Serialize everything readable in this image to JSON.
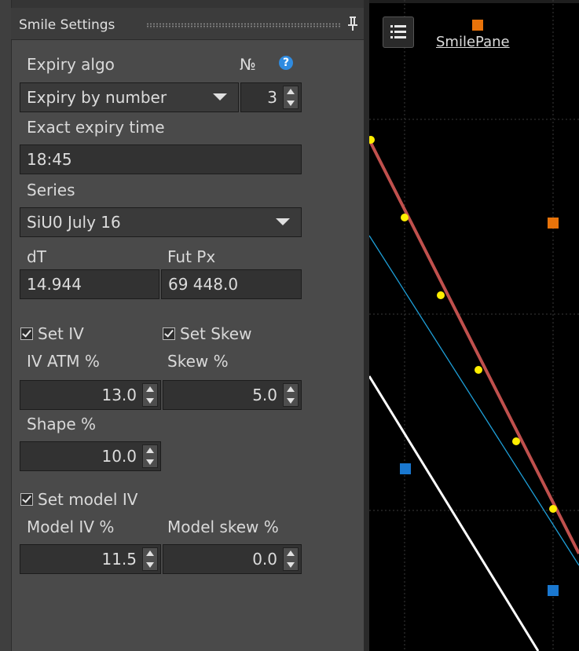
{
  "panel": {
    "title": "Smile Settings",
    "expiry_algo_label": "Expiry algo",
    "number_label": "№",
    "expiry_algo_value": "Expiry by number",
    "expiry_number": "3",
    "exact_expiry_label": "Exact expiry time",
    "exact_expiry_value": "18:45",
    "series_label": "Series",
    "series_value": "SiU0 July 16",
    "dt_label": "dT",
    "dt_value": "14.944",
    "futpx_label": "Fut Px",
    "futpx_value": "69 448.0",
    "set_iv_label": "Set IV",
    "set_skew_label": "Set Skew",
    "iv_atm_label": "IV ATM %",
    "iv_atm_value": "13.0",
    "skew_label": "Skew %",
    "skew_value": "5.0",
    "shape_label": "Shape %",
    "shape_value": "10.0",
    "set_model_iv_label": "Set model IV",
    "model_iv_label": "Model IV %",
    "model_iv_value": "11.5",
    "model_skew_label": "Model skew %",
    "model_skew_value": "0.0"
  },
  "pane": {
    "title": "SmilePane",
    "colors": {
      "smile_line": "#c0504d",
      "model_line": "#1e9fd8",
      "white_line": "#ffffff",
      "points": "#ffee00",
      "orange_marker": "#e8730a",
      "blue_marker": "#1a78d0"
    }
  }
}
